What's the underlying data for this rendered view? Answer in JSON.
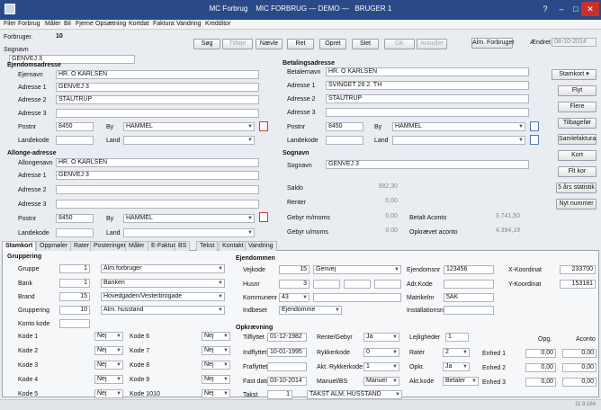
{
  "title": {
    "app": "MC Forbrug",
    "main": "MIC FORBRUG — DEMO —",
    "user": "BRUGER 1"
  },
  "menu": [
    "Filer",
    "Forbrug",
    "Måler",
    "Bil",
    "Fjerne",
    "Opsætning",
    "Kortdat",
    "Faktura",
    "Vandring",
    "Kredditor"
  ],
  "toolbar": {
    "forbruger_label": "Forbruger.",
    "forbruger_value": "10",
    "sognavn_label": "Sognavn",
    "sognavn_value": "GENVEJ 3",
    "buttons": [
      "Søg",
      "Tilføje",
      "Nævle",
      "Ret",
      "Opret",
      "Slet",
      "OK",
      "Annuller",
      "Alm. Forbruger"
    ],
    "aendret_label": "Ændret",
    "aendret_value": "08-10-2014"
  },
  "ejendom": {
    "title": "Ejendomsadresse",
    "ejernavn_label": "Ejernavn",
    "ejernavn": "HR. O KARLSEN",
    "adr1_label": "Adresse 1",
    "adr1": "GENVEJ 3",
    "adr2_label": "Adresse 2",
    "adr2": "STAUTRUP",
    "adr3_label": "Adresse 3",
    "adr3": "",
    "postnr_label": "Postnr",
    "postnr": "8450",
    "by_label": "By",
    "by": "HAMMEL",
    "landekode_label": "Landekode",
    "landekode": "",
    "land_label": "Land",
    "land": ""
  },
  "betaling": {
    "title": "Betalingsadresse",
    "navn_label": "Betalernavn",
    "navn": "HR. O KARLSEN",
    "adr1_label": "Adresse 1",
    "adr1": "SVINGET 28 2. TH",
    "adr2_label": "Adresse 2",
    "adr2": "STAUTRUP",
    "adr3_label": "Adresse 3",
    "adr3": "",
    "postnr_label": "Postnr",
    "postnr": "8450",
    "by_label": "By",
    "by": "HAMMEL",
    "landekode_label": "Landekode",
    "landekode": "",
    "land_label": "Land",
    "land": ""
  },
  "allonge": {
    "title": "Allonge-adresse",
    "navn_label": "Allongenavn",
    "navn": "HR. O KARLSEN",
    "adr1_label": "Adresse 1",
    "adr1": "GENVEJ 3",
    "adr2_label": "Adresse 2",
    "adr2": "",
    "adr3_label": "Adresse 3",
    "adr3": "",
    "postnr_label": "Postnr",
    "postnr": "8450",
    "by_label": "By",
    "by": "HAMMEL",
    "landekode_label": "Landekode",
    "landekode": "",
    "land_label": "Land",
    "land": ""
  },
  "sognavn2": {
    "title": "Sognavn",
    "label": "Sognavn",
    "value": "GENVEJ 3"
  },
  "saldo": {
    "saldo_label": "Saldo",
    "saldo": "582,30",
    "renter_label": "Renter",
    "renter": "0,00",
    "gebyr_m_label": "Gebyr m/moms",
    "gebyr_m": "0,00",
    "gebyr_u_label": "Gebyr u/moms",
    "gebyr_u": "0,00",
    "aconto_label": "Betalt Aconto",
    "aconto": "3.741,50",
    "opkraevet_label": "Opkrævet aconto",
    "opkraevet": "4.394,19"
  },
  "side_buttons": [
    "Stamkort",
    "Flyt",
    "Flere",
    "Tilbagefør",
    "Samlefaktura",
    "Kort",
    "Flt kor",
    "5 års statistik",
    "Nyt nummer"
  ],
  "tabs": [
    "Stamkort",
    "Oppmøler",
    "Rater",
    "Posteringer",
    "Måler",
    "E-Faktura",
    "BS",
    "Tekst",
    "Kontakt",
    "Vandring"
  ],
  "gruppering": {
    "title": "Gruppering",
    "gruppe_label": "Gruppe",
    "gruppe_nr": "1",
    "gruppe": "Alm.forbruger",
    "bank_label": "Bank",
    "bank_nr": "1",
    "bank": "Banken",
    "brand_label": "Brand",
    "brand_nr": "15",
    "brand": "Hovedgaden/Vesterbrogade",
    "grup_label": "Gruppering",
    "grup_nr": "10",
    "grup": "Alm. husstand",
    "konto_label": "Konto kode",
    "konto_nr": ""
  },
  "koder": {
    "rows": [
      {
        "l": "Kode 1",
        "v": "Nej",
        "l2": "Kode 6",
        "v2": "Nej"
      },
      {
        "l": "Kode 2",
        "v": "Nej",
        "l2": "Kode 7",
        "v2": "Nej"
      },
      {
        "l": "Kode 3",
        "v": "Nej",
        "l2": "Kode 8",
        "v2": "Nej"
      },
      {
        "l": "Kode 4",
        "v": "Nej",
        "l2": "Kode 9",
        "v2": "Nej"
      },
      {
        "l": "Kode 5",
        "v": "Nej",
        "l2": "Kode 1010",
        "v2": "Nej"
      }
    ]
  },
  "ejendommen": {
    "title": "Ejendommen",
    "vejkode_label": "Vejkode",
    "vejkode": "15",
    "vej": "Genvej",
    "husnr_label": "Husnr",
    "husnr": "3",
    "kommune_label": "Kommunenr",
    "kommune": "43",
    "indbeset_label": "Indbeset",
    "indbeset": "Ejendomme",
    "ejendomsnr_label": "Ejendomsnr",
    "ejendomsnr": "123456",
    "adrkode_label": "Adr.Kode",
    "adrkode": "",
    "matrikel_label": "Matrikelnr",
    "matrikel": "5AK",
    "install_label": "Installationsnr",
    "install": "",
    "xkoord_label": "X-Koordinat",
    "xkoord": "233700",
    "ykoord_label": "Y-Koordinat",
    "ykoord": "153181"
  },
  "opkraevning": {
    "title": "Opkrævning",
    "tilflyttet_label": "Tilflyttet",
    "tilflyttet": "01-12-1982",
    "indflyttet_label": "Indflyttet",
    "indflyttet": "10-01-1995",
    "fraflyttet_label": "Fraflyttet",
    "fraflyttet": "",
    "fast_label": "Fast dato",
    "fast": "03-10-2014",
    "takst_label": "Takst",
    "takst_nr": "1",
    "takst": "TAKST ALM. HUSSTAND",
    "rente_label": "Rente/Gebyr",
    "rente": "Ja",
    "rykker_label": "Rykkerkode",
    "rykker": "0",
    "aktryk_label": "Akt. Rykkerkode",
    "aktryk": "1",
    "manuel_label": "Manuel/BS",
    "manuel": "Manuel",
    "lejlighed_label": "Lejligheder",
    "lejlighed": "1",
    "rater_label": "Rater",
    "rater": "2",
    "opkr_label": "Opkr.",
    "opkr": "Ja",
    "aktkode_label": "Akt.kode",
    "aktkode": "Betaler",
    "opg_label": "Opg.",
    "aconto_label": "Aconto",
    "enheder": [
      {
        "l": "Enhed 1",
        "o": "0,00",
        "a": "0,00"
      },
      {
        "l": "Enhed 2",
        "o": "0,00",
        "a": "0,00"
      },
      {
        "l": "Enhed 3",
        "o": "0,00",
        "a": "0,00"
      }
    ]
  },
  "status": {
    "version": "11.9.184"
  }
}
